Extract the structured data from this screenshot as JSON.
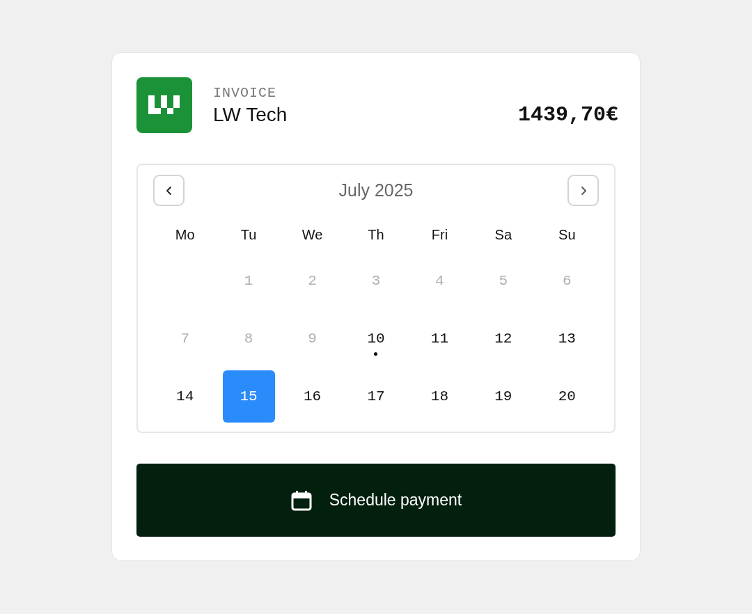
{
  "invoice": {
    "label": "INVOICE",
    "company": "LW Tech",
    "amount": "1439,70€"
  },
  "calendar": {
    "month": "July 2025",
    "weekdays": [
      "Mo",
      "Tu",
      "We",
      "Th",
      "Fri",
      "Sa",
      "Su"
    ],
    "weeks": [
      [
        {
          "kind": "blank"
        },
        {
          "kind": "day",
          "label": "1",
          "disabled": true,
          "today": false,
          "selected": false
        },
        {
          "kind": "day",
          "label": "2",
          "disabled": true,
          "today": false,
          "selected": false
        },
        {
          "kind": "day",
          "label": "3",
          "disabled": true,
          "today": false,
          "selected": false
        },
        {
          "kind": "day",
          "label": "4",
          "disabled": true,
          "today": false,
          "selected": false
        },
        {
          "kind": "day",
          "label": "5",
          "disabled": true,
          "today": false,
          "selected": false
        },
        {
          "kind": "day",
          "label": "6",
          "disabled": true,
          "today": false,
          "selected": false
        }
      ],
      [
        {
          "kind": "day",
          "label": "7",
          "disabled": true,
          "today": false,
          "selected": false
        },
        {
          "kind": "day",
          "label": "8",
          "disabled": true,
          "today": false,
          "selected": false
        },
        {
          "kind": "day",
          "label": "9",
          "disabled": true,
          "today": false,
          "selected": false
        },
        {
          "kind": "day",
          "label": "10",
          "disabled": false,
          "today": true,
          "selected": false
        },
        {
          "kind": "day",
          "label": "11",
          "disabled": false,
          "today": false,
          "selected": false
        },
        {
          "kind": "day",
          "label": "12",
          "disabled": false,
          "today": false,
          "selected": false
        },
        {
          "kind": "day",
          "label": "13",
          "disabled": false,
          "today": false,
          "selected": false
        }
      ],
      [
        {
          "kind": "day",
          "label": "14",
          "disabled": false,
          "today": false,
          "selected": false
        },
        {
          "kind": "day",
          "label": "15",
          "disabled": false,
          "today": false,
          "selected": true
        },
        {
          "kind": "day",
          "label": "16",
          "disabled": false,
          "today": false,
          "selected": false
        },
        {
          "kind": "day",
          "label": "17",
          "disabled": false,
          "today": false,
          "selected": false
        },
        {
          "kind": "day",
          "label": "18",
          "disabled": false,
          "today": false,
          "selected": false
        },
        {
          "kind": "day",
          "label": "19",
          "disabled": false,
          "today": false,
          "selected": false
        },
        {
          "kind": "day",
          "label": "20",
          "disabled": false,
          "today": false,
          "selected": false
        }
      ]
    ]
  },
  "button": {
    "label": "Schedule payment"
  }
}
